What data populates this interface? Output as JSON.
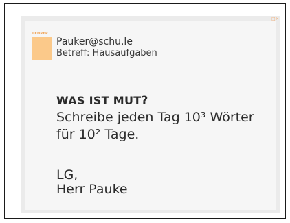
{
  "window": {
    "controls": [
      "-",
      "□",
      "×"
    ]
  },
  "sender": {
    "label": "LEHRER",
    "address": "Pauker@schu.le",
    "subject": "Betreff: Hausaufgaben"
  },
  "message": {
    "heading_main": "WAS IST MUT",
    "heading_mark": "?",
    "line1": "Schreibe jeden Tag 10³ Wörter",
    "line2": "für 10² Tage.",
    "greeting": "LG,",
    "signature": "Herr Pauke"
  },
  "colors": {
    "accent": "#fbc98a",
    "accent_text": "#f0a050",
    "window_bg": "#ebebeb",
    "panel_bg": "#f6f6f6"
  }
}
